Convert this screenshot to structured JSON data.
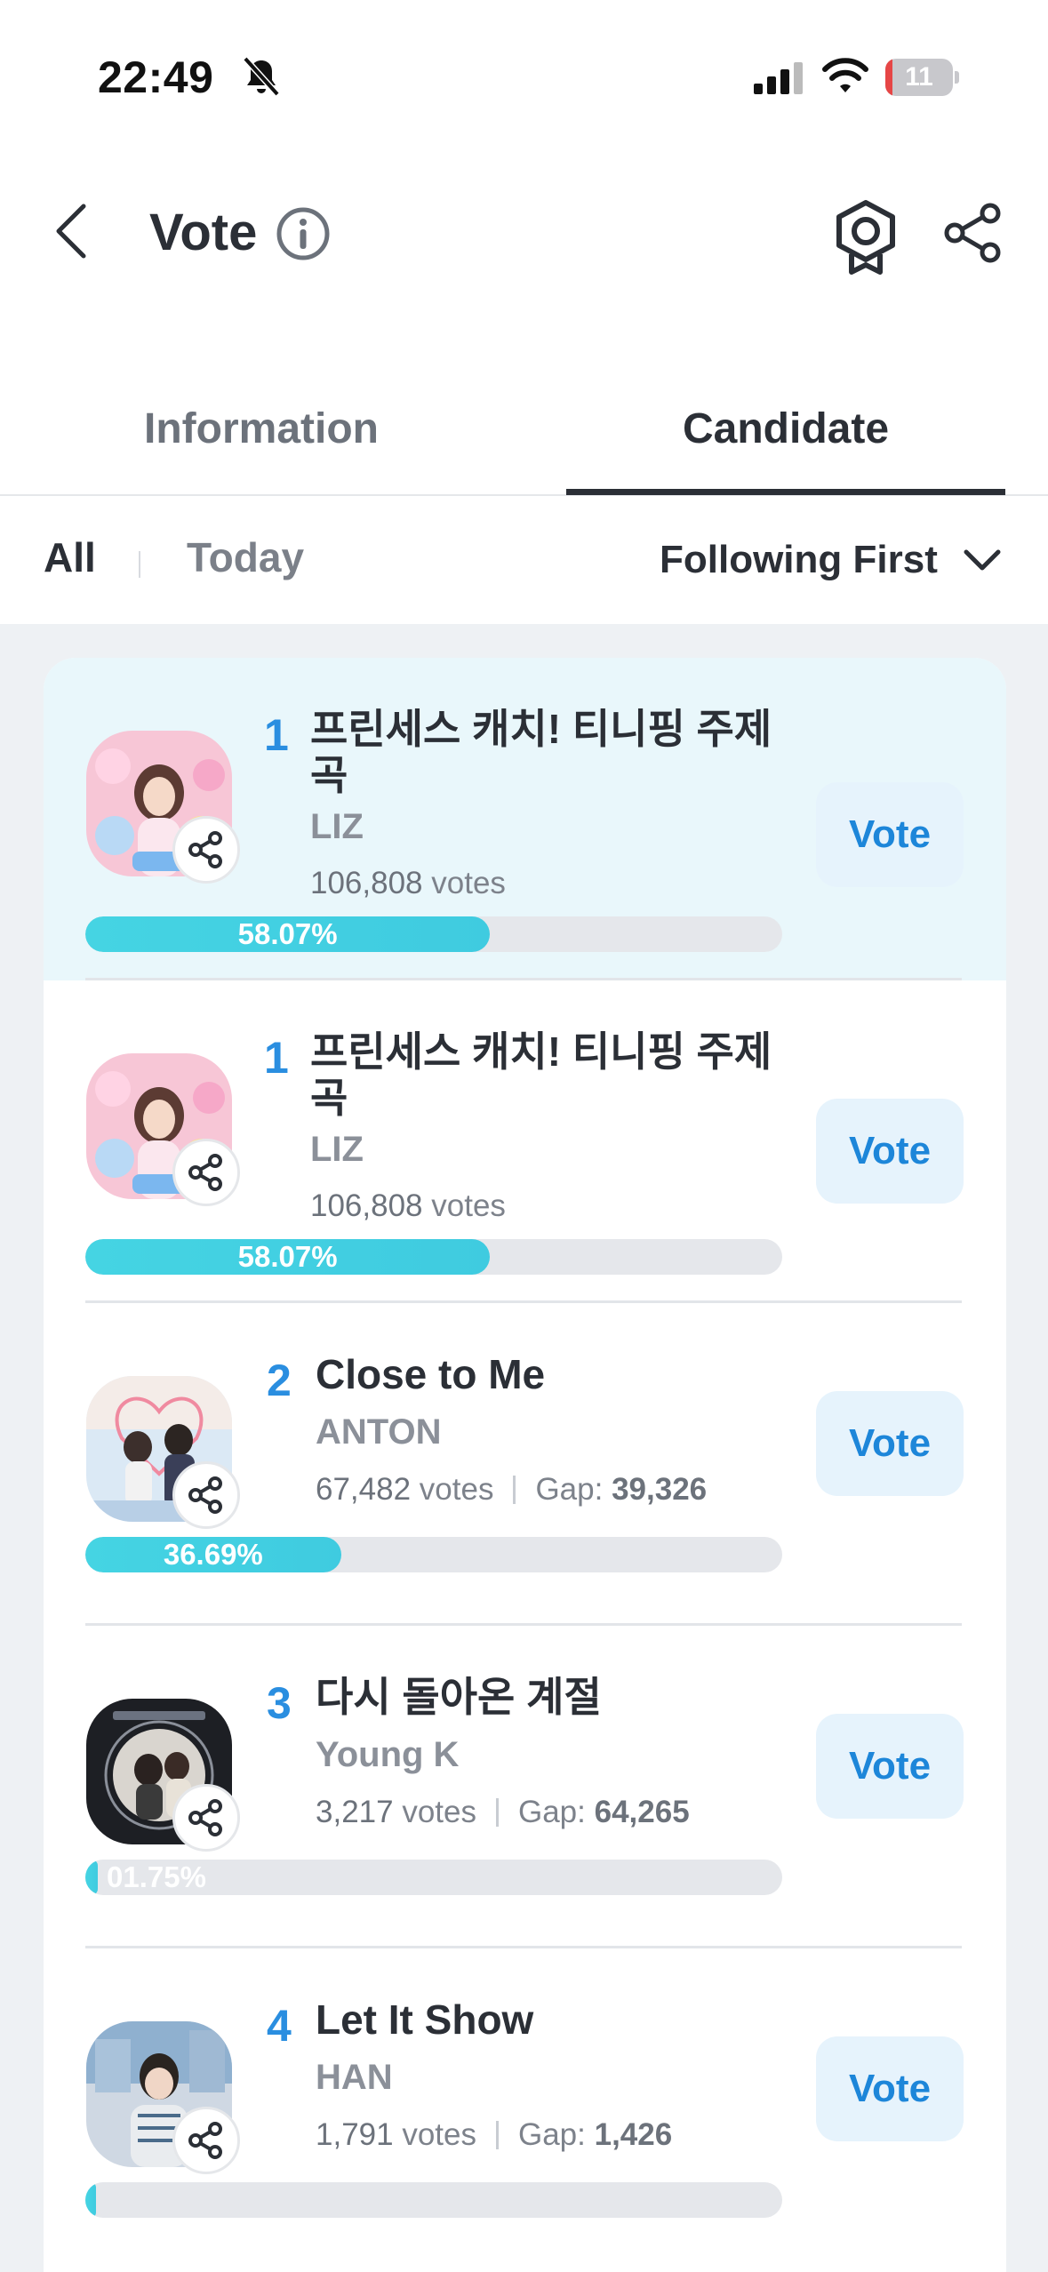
{
  "status_bar": {
    "time": "22:49",
    "battery": "11",
    "battery_level": 0.11
  },
  "header": {
    "title": "Vote"
  },
  "tabs": [
    {
      "label": "Information",
      "active": false
    },
    {
      "label": "Candidate",
      "active": true
    }
  ],
  "filters": {
    "all": "All",
    "today": "Today",
    "sort": "Following First"
  },
  "candidates": [
    {
      "rank": "1",
      "title": "프린세스 캐치! 티니핑 주제곡",
      "artist": "LIZ",
      "votes": "106,808",
      "votes_unit": "votes",
      "percent": "58.07%",
      "percent_value": 58.07,
      "vote_label": "Vote",
      "highlight": true
    },
    {
      "rank": "1",
      "title": "프린세스 캐치! 티니핑 주제곡",
      "artist": "LIZ",
      "votes": "106,808",
      "votes_unit": "votes",
      "percent": "58.07%",
      "percent_value": 58.07,
      "vote_label": "Vote"
    },
    {
      "rank": "2",
      "title": "Close to Me",
      "artist": "ANTON",
      "votes": "67,482",
      "votes_unit": "votes",
      "gap_label": "Gap:",
      "gap": "39,326",
      "percent": "36.69%",
      "percent_value": 36.69,
      "vote_label": "Vote"
    },
    {
      "rank": "3",
      "title": "다시 돌아온 계절",
      "artist": "Young K",
      "votes": "3,217",
      "votes_unit": "votes",
      "gap_label": "Gap:",
      "gap": "64,265",
      "percent": "01.75%",
      "percent_value": 1.75,
      "vote_label": "Vote"
    },
    {
      "rank": "4",
      "title": "Let It Show",
      "artist": "HAN",
      "votes": "1,791",
      "votes_unit": "votes",
      "gap_label": "Gap:",
      "gap": "1,426",
      "percent": "",
      "percent_value": 0.97,
      "vote_label": "Vote"
    }
  ],
  "colors": {
    "accent": "#1d86d9",
    "progress": "#45d4e3",
    "highlight_row": "#e9f7fb"
  }
}
